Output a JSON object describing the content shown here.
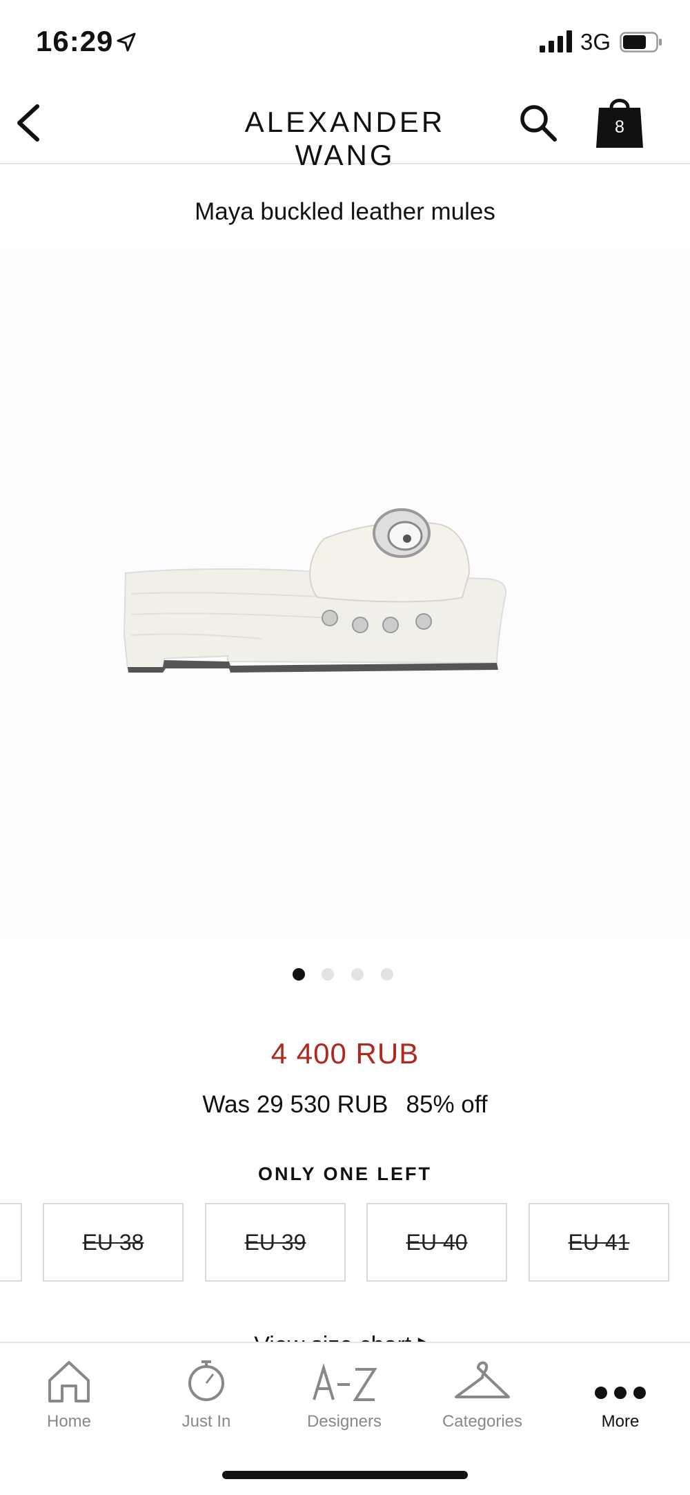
{
  "status_bar": {
    "time": "16:29",
    "network": "3G"
  },
  "header": {
    "brand": "ALEXANDER WANG",
    "bag_count": "8"
  },
  "product": {
    "title": "Maya buckled leather mules",
    "price": "4 400 RUB",
    "was_price": "Was 29 530 RUB",
    "discount": "85% off",
    "stock_note": "ONLY ONE LEFT",
    "gallery_page": 1,
    "gallery_total": 4
  },
  "sizes": [
    "EU 38",
    "EU 39",
    "EU 40",
    "EU 41"
  ],
  "view_link": "View size chart ▶",
  "tab_bar": {
    "tabs": [
      {
        "label": "Home",
        "icon": "house-icon"
      },
      {
        "label": "Just In",
        "icon": "stopwatch-icon"
      },
      {
        "label": "Designers",
        "icon": "a-z-icon"
      },
      {
        "label": "Categories",
        "icon": "hanger-icon"
      },
      {
        "label": "More",
        "icon": "ellipsis-icon"
      }
    ],
    "active": "More"
  },
  "colors": {
    "sale_price": "#b0281e",
    "text": "#111111",
    "border": "#d9d9d9"
  }
}
